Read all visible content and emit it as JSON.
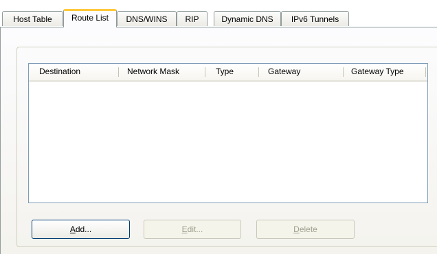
{
  "tabs": [
    {
      "label": "Host Table",
      "active": false
    },
    {
      "label": "Route List",
      "active": true
    },
    {
      "label": "DNS/WINS",
      "active": false
    },
    {
      "label": "RIP",
      "active": false
    },
    {
      "label": "Dynamic DNS",
      "active": false
    },
    {
      "label": "IPv6 Tunnels",
      "active": false
    }
  ],
  "route_list": {
    "columns": [
      "Destination",
      "Network Mask",
      "Type",
      "Gateway",
      "Gateway Type"
    ],
    "rows": []
  },
  "buttons": {
    "add": {
      "mnemonic": "A",
      "rest": "dd...",
      "enabled": true
    },
    "edit": {
      "mnemonic": "E",
      "rest": "dit...",
      "enabled": false
    },
    "delete": {
      "mnemonic": "D",
      "rest": "elete",
      "enabled": false
    }
  }
}
